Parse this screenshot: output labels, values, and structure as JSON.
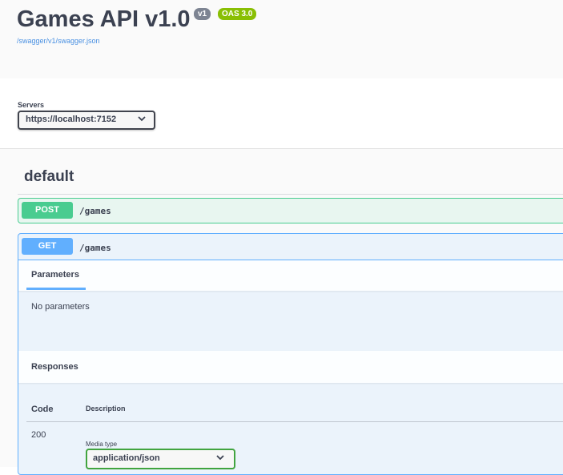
{
  "info": {
    "title": "Games API v1.0",
    "version_badge": "v1",
    "oas_badge": "OAS 3.0",
    "spec_link": "/swagger/v1/swagger.json"
  },
  "servers": {
    "label": "Servers",
    "selected": "https://localhost:7152"
  },
  "tag": {
    "name": "default"
  },
  "operations": [
    {
      "method": "POST",
      "path": "/games",
      "color": "#49cc90"
    },
    {
      "method": "GET",
      "path": "/games",
      "color": "#61affe"
    }
  ],
  "get_details": {
    "parameters_tab": "Parameters",
    "no_parameters": "No parameters",
    "responses_label": "Responses",
    "col_code": "Code",
    "col_description": "Description",
    "response_code": "200",
    "media_type_label": "Media type",
    "media_type_selected": "application/json"
  },
  "icons": {
    "chevron": "chevron-down-icon"
  }
}
